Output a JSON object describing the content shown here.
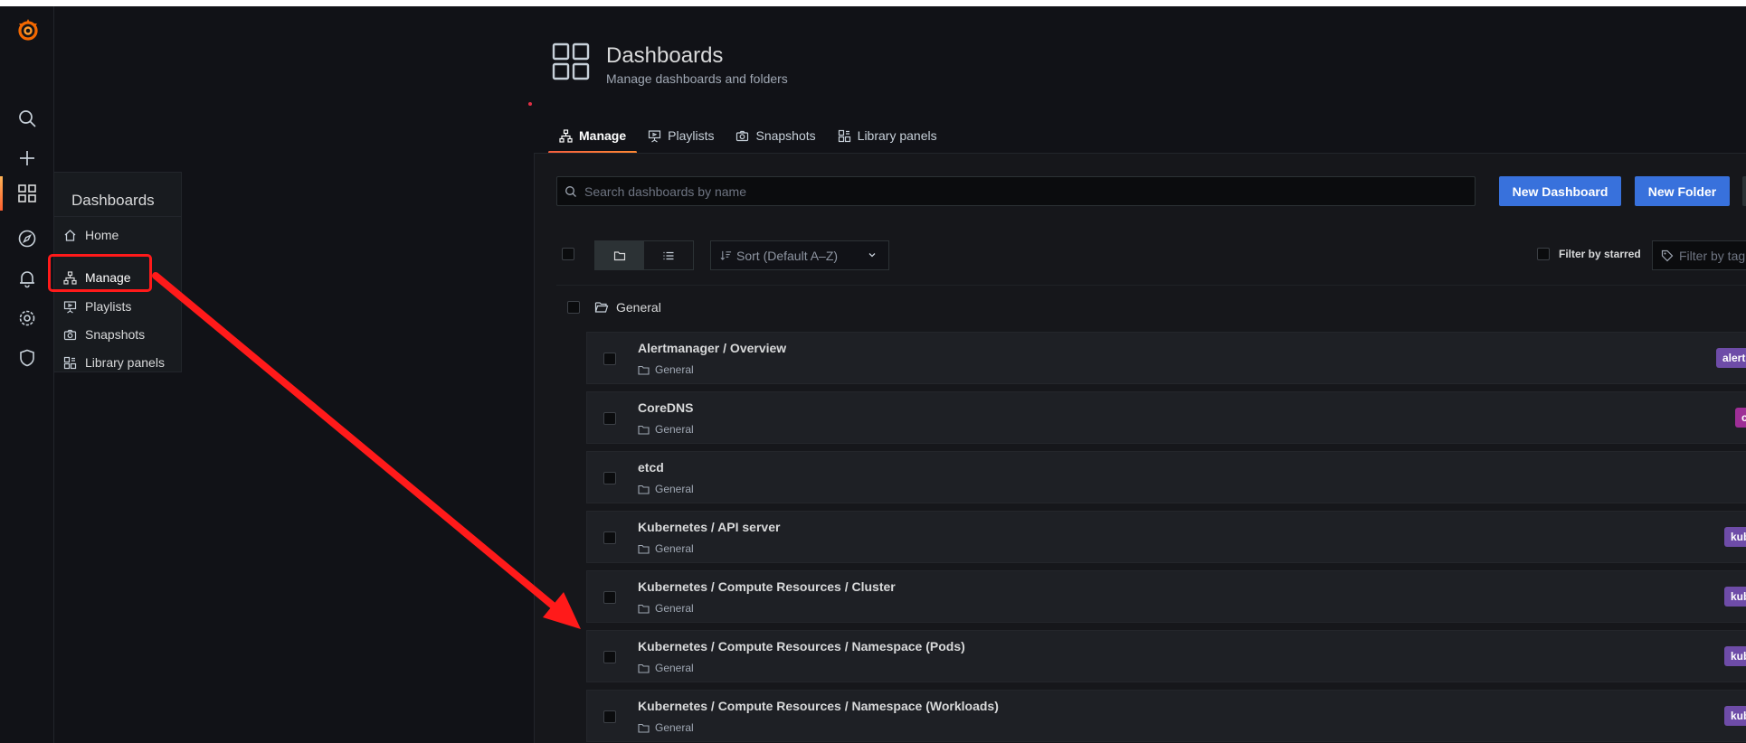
{
  "colors": {
    "accent": "#ff7f2e",
    "primary_button": "#3871dc",
    "annotation": "#ff1a1a",
    "tag_purple": "#6e4ca8",
    "tag_magenta": "#9e2e96",
    "background": "#111217"
  },
  "rail": {
    "logo": "grafana-logo",
    "items": [
      {
        "name": "search-icon"
      },
      {
        "name": "plus-icon"
      },
      {
        "name": "dashboards-grid-icon"
      },
      {
        "name": "compass-icon"
      },
      {
        "name": "bell-icon"
      },
      {
        "name": "gear-icon"
      },
      {
        "name": "shield-icon"
      }
    ]
  },
  "flyout": {
    "title": "Dashboards",
    "items": [
      {
        "label": "Home",
        "icon": "home-icon"
      },
      {
        "label": "Manage",
        "icon": "sitemap-icon"
      },
      {
        "label": "Playlists",
        "icon": "presentation-icon"
      },
      {
        "label": "Snapshots",
        "icon": "camera-icon"
      },
      {
        "label": "Library panels",
        "icon": "library-panels-icon"
      }
    ]
  },
  "header": {
    "title": "Dashboards",
    "subtitle": "Manage dashboards and folders",
    "icon": "dashboards-grid-icon"
  },
  "tabs": [
    {
      "label": "Manage",
      "active": true,
      "icon": "sitemap-icon"
    },
    {
      "label": "Playlists",
      "active": false,
      "icon": "presentation-icon"
    },
    {
      "label": "Snapshots",
      "active": false,
      "icon": "camera-icon"
    },
    {
      "label": "Library panels",
      "active": false,
      "icon": "library-panels-icon"
    }
  ],
  "toolbar": {
    "search_placeholder": "Search dashboards by name",
    "new_dashboard_label": "New Dashboard",
    "new_folder_label": "New Folder",
    "sort_label": "Sort (Default A–Z)",
    "filter_starred_label": "Filter by starred",
    "filter_tag_placeholder": "Filter by tag"
  },
  "folder": {
    "name": "General"
  },
  "dashboards": [
    {
      "title": "Alertmanager / Overview",
      "folder": "General",
      "tag": "alertmanager-mixin",
      "tag_color": "#6e4ca8"
    },
    {
      "title": "CoreDNS",
      "folder": "General",
      "tag": "coredns",
      "tag_color": "#9e2e96"
    },
    {
      "title": "etcd",
      "folder": "General",
      "tag": "",
      "tag_color": ""
    },
    {
      "title": "Kubernetes / API server",
      "folder": "General",
      "tag": "kubernetes-mixin",
      "tag_color": "#6e4ca8"
    },
    {
      "title": "Kubernetes / Compute Resources / Cluster",
      "folder": "General",
      "tag": "kubernetes-mixin",
      "tag_color": "#6e4ca8"
    },
    {
      "title": "Kubernetes / Compute Resources / Namespace (Pods)",
      "folder": "General",
      "tag": "kubernetes-mixin",
      "tag_color": "#6e4ca8"
    },
    {
      "title": "Kubernetes / Compute Resources / Namespace (Workloads)",
      "folder": "General",
      "tag": "kubernetes-mixin",
      "tag_color": "#6e4ca8"
    }
  ]
}
